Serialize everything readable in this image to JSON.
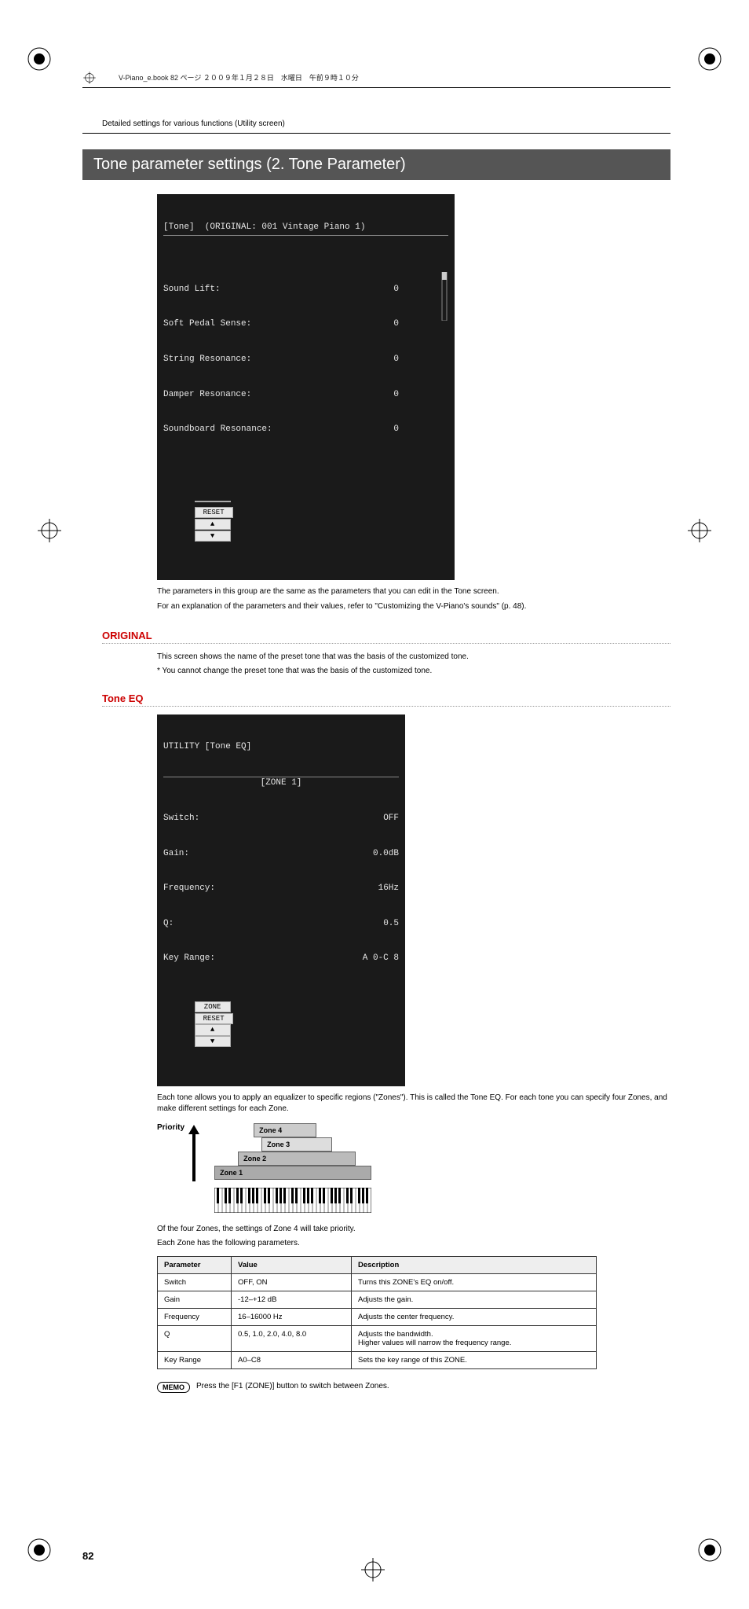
{
  "bookNote": "V-Piano_e.book  82 ページ  ２００９年１月２８日　水曜日　午前９時１０分",
  "breadcrumb": "Detailed settings for various functions (Utility screen)",
  "sectionTitle": "Tone parameter settings (2. Tone Parameter)",
  "lcd1": {
    "title": "[Tone]  (ORIGINAL: 001 Vintage Piano 1)",
    "rows": [
      {
        "label": "Sound Lift:",
        "value": "0"
      },
      {
        "label": "Soft Pedal Sense:",
        "value": "0"
      },
      {
        "label": "String Resonance:",
        "value": "0"
      },
      {
        "label": "Damper Resonance:",
        "value": "0"
      },
      {
        "label": "Soundboard Resonance:",
        "value": "0"
      }
    ],
    "fnButtons": [
      "",
      "RESET",
      "▲",
      "▼"
    ]
  },
  "paraAfterLcd1a": "The parameters in this group are the same as the parameters that you can edit in the Tone screen.",
  "paraAfterLcd1b": "For an explanation of the parameters and their values, refer to  \"Customizing the V-Piano's sounds\" (p. 48).",
  "original": {
    "title": "ORIGINAL",
    "body": "This screen shows the name of the preset tone that was the basis of the customized tone.",
    "note": "*  You cannot change the preset tone that was the basis of the customized tone."
  },
  "toneEq": {
    "title": "Tone EQ",
    "lcd": {
      "title": "UTILITY [Tone EQ]",
      "zone": "[ZONE 1]",
      "rows": [
        {
          "label": "Switch:",
          "value": "OFF"
        },
        {
          "label": "Gain:",
          "value": "0.0dB"
        },
        {
          "label": "Frequency:",
          "value": "16Hz"
        },
        {
          "label": "Q:",
          "value": "0.5"
        },
        {
          "label": "Key Range:",
          "value": "A 0-C 8"
        }
      ],
      "fnButtons": [
        "ZONE",
        "RESET",
        "▲",
        "▼"
      ]
    },
    "para1": "Each tone allows you to apply an equalizer to specific regions (\"Zones\"). This is called the Tone EQ. For each tone you can specify four Zones, and make different settings for each Zone.",
    "priorityLabel": "Priority",
    "zones": [
      "Zone 4",
      "Zone 3",
      "Zone 2",
      "Zone 1"
    ],
    "para2": "Of the four Zones, the settings of Zone 4 will take priority.",
    "para3": "Each Zone has the following parameters.",
    "tableHeaders": [
      "Parameter",
      "Value",
      "Description"
    ],
    "tableRows": [
      {
        "param": "Switch",
        "value": "OFF, ON",
        "desc": "Turns this ZONE's EQ on/off."
      },
      {
        "param": "Gain",
        "value": "-12–+12 dB",
        "desc": "Adjusts the gain."
      },
      {
        "param": "Frequency",
        "value": "16–16000 Hz",
        "desc": "Adjusts the center frequency."
      },
      {
        "param": "Q",
        "value": "0.5, 1.0, 2.0, 4.0, 8.0",
        "desc": "Adjusts the bandwidth.\nHigher values will narrow the frequency range."
      },
      {
        "param": "Key Range",
        "value": "A0–C8",
        "desc": "Sets the key range of this ZONE."
      }
    ],
    "memoLabel": "MEMO",
    "memoText": "Press the [F1 (ZONE)] button to switch between Zones."
  },
  "pageNumber": "82"
}
